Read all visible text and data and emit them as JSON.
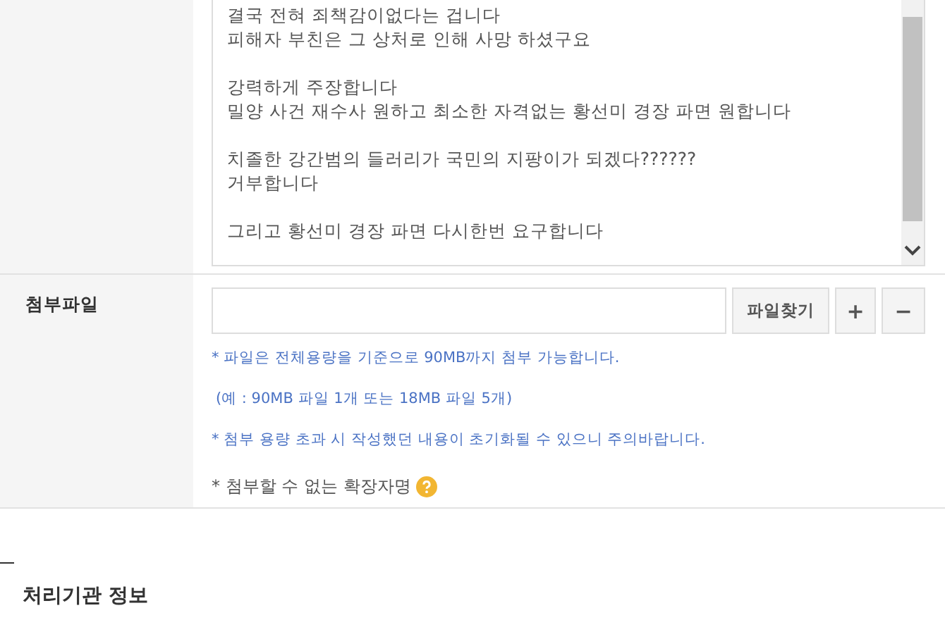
{
  "content_box": {
    "paragraphs": [
      [
        "결국 전혀 죄책감이없다는 겁니다",
        "피해자 부친은 그 상처로 인해 사망 하셨구요"
      ],
      [
        "강력하게 주장합니다",
        "밀양 사건 재수사 원하고 최소한 자격없는 황선미 경장 파면 원합니다"
      ],
      [
        "치졸한 강간범의 들러리가 국민의 지팡이가 되겠다??????",
        "거부합니다"
      ],
      [
        "그리고 황선미 경장 파면 다시한번 요구합니다"
      ]
    ]
  },
  "attachment": {
    "label": "첨부파일",
    "find_button": "파일찾기",
    "add_button": "+",
    "remove_button": "−",
    "notes": [
      {
        "kind": "info",
        "text": "* 파일은 전체용량을 기준으로 90MB까지 첨부 가능합니다."
      },
      {
        "kind": "info",
        "text": "(예 : 90MB 파일 1개 또는 18MB 파일 5개)"
      },
      {
        "kind": "info",
        "text": "* 첨부 용량 초과 시 작성했던 내용이 초기화될 수 있으니 주의바랍니다."
      },
      {
        "kind": "help",
        "text": "* 첨부할 수 없는 확장자명"
      }
    ]
  },
  "section": {
    "title": "처리기관 정보"
  }
}
